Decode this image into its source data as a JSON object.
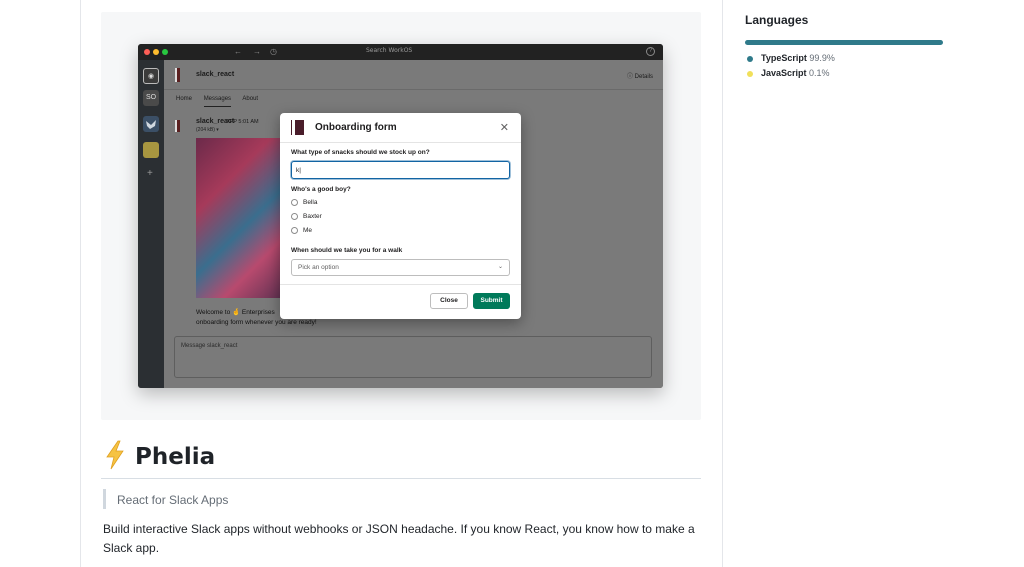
{
  "readme": {
    "title": "Phelia",
    "tagline": "React for Slack Apps",
    "description": "Build interactive Slack apps without webhooks or JSON headache. If you know React, you know how to make a Slack app."
  },
  "screenshot": {
    "titlebar": {
      "search": "Search WorkOS"
    },
    "sidebar": [
      "SO"
    ],
    "channel": {
      "name": "slack_react",
      "details": "Details",
      "tabs": [
        "Home",
        "Messages",
        "About"
      ],
      "active_tab": "Messages",
      "message_author": "slack_react",
      "message_meta": "APP  5:01 AM",
      "message_sub": "(204 kB) ▾",
      "message_text_1": "Welcome to 🤞 Enterprises",
      "message_text_2": "onboarding form whenever you are ready!",
      "composer_placeholder": "Message slack_react"
    },
    "modal": {
      "title": "Onboarding form",
      "q1_label": "What type of snacks should we stock up on?",
      "q1_value": "k|",
      "q2_label": "Who's a good boy?",
      "options": [
        "Bella",
        "Baxter",
        "Me"
      ],
      "q3_label": "When should we take you for a walk",
      "select_placeholder": "Pick an option",
      "close_label": "Close",
      "submit_label": "Submit"
    }
  },
  "languages": {
    "title": "Languages",
    "items": [
      {
        "name": "TypeScript",
        "percent": "99.9%",
        "fraction": 0.999,
        "color": "#2f7a8a"
      },
      {
        "name": "JavaScript",
        "percent": "0.1%",
        "fraction": 0.001,
        "color": "#f1e05a"
      }
    ]
  },
  "colors": {
    "slack_green": "#007a5a",
    "focus_blue": "#1264a3"
  }
}
